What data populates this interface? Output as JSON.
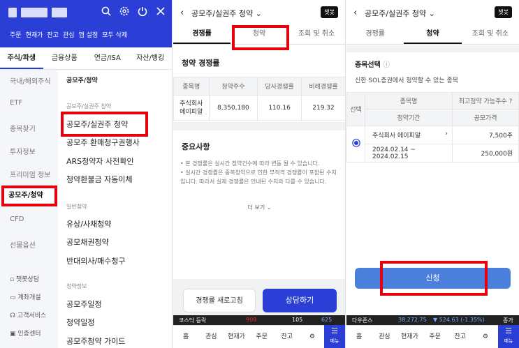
{
  "panel1": {
    "chips": [
      "주문",
      "현재가",
      "잔고",
      "관심",
      "앱 설정",
      "모두 삭제"
    ],
    "tabs": [
      "주식/파생",
      "금융상품",
      "연금/ISA",
      "자산/뱅킹"
    ],
    "left_menu": [
      "국내/해외주식",
      "ETF",
      "종목찾기",
      "투자정보",
      "프리미엄 정보",
      "공모주/청약",
      "CFD",
      "선물옵션"
    ],
    "left_footer": [
      "챗봇상담",
      "계좌개설",
      "고객서비스",
      "인증센터"
    ],
    "right_header": "공모주/청약",
    "section1": "공모주/실권주 청약",
    "links1": [
      "공모주/실권주 청약",
      "공모주 환매청구권행사",
      "ARS청약자 사전확인",
      "청약환불금 자동이체"
    ],
    "section2": "일반청약",
    "links2": [
      "유상/사채청약",
      "공모채권청약",
      "반대의사/매수청구"
    ],
    "section3": "청약정보",
    "links3": [
      "공모주일정",
      "청약일정",
      "공모주청약 가이드"
    ]
  },
  "panel2": {
    "title": "공모주/실권주 청약",
    "chatbot": "챗봇",
    "tabs": [
      "경쟁률",
      "청약",
      "조회 및 취소"
    ],
    "section_title": "청약 경쟁률",
    "table_headers": [
      "종목명",
      "청약주수",
      "당사경쟁률",
      "비례경쟁률"
    ],
    "row": {
      "name_line1": "주식회사",
      "name_line2": "에이피알",
      "shares": "8,350,180",
      "company_rate": "110.16",
      "prop_rate": "219.32"
    },
    "notes_title": "중요사항",
    "notes": [
      "본 경쟁률은 실시간 청약건수에 따라 변동 될 수 있습니다.",
      "실시간 경쟁률은 중복청약으로 인한 부적격 경쟁률이 포함된 수치입니다. 따라서 실제 경쟁률은 안내된 수치와 다를 수 있습니다."
    ],
    "more": "더 보기",
    "refresh_btn": "경쟁률 새로고침",
    "consult_btn": "상담하기",
    "ticker": {
      "label": "코스닥 등락",
      "v1": "908",
      "v2": "105",
      "v3": "625"
    },
    "nav": [
      "홈",
      "관심",
      "현재가",
      "주문",
      "잔고"
    ],
    "menu": "메뉴"
  },
  "panel3": {
    "title": "공모주/실권주 청약",
    "chatbot": "챗봇",
    "tabs": [
      "경쟁률",
      "청약",
      "조회 및 취소"
    ],
    "section_title": "종목선택",
    "info_text": "신한 SOL증권에서 청약할 수 있는 종목",
    "table": {
      "select_label": "선택",
      "h_name": "종목명",
      "h_limit": "최고청약 가능주수",
      "h_period": "청약기간",
      "h_price": "공모가격",
      "name": "주식회사 에이피알",
      "limit": "7,500주",
      "period": "2024.02.14 ~ 2024.02.15",
      "price": "250,000원"
    },
    "apply_btn": "신청",
    "ticker": {
      "label": "다우존스",
      "value": "38,272.75",
      "change": "▼ 524.63 (-1.35%)",
      "extra": "종가"
    },
    "nav": [
      "홈",
      "관심",
      "현재가",
      "주문",
      "잔고"
    ],
    "menu": "메뉴"
  },
  "colors": {
    "brand_blue": "#2b3fd6",
    "highlight_red": "#e8000f",
    "apply_blue": "#4a7fdc"
  }
}
